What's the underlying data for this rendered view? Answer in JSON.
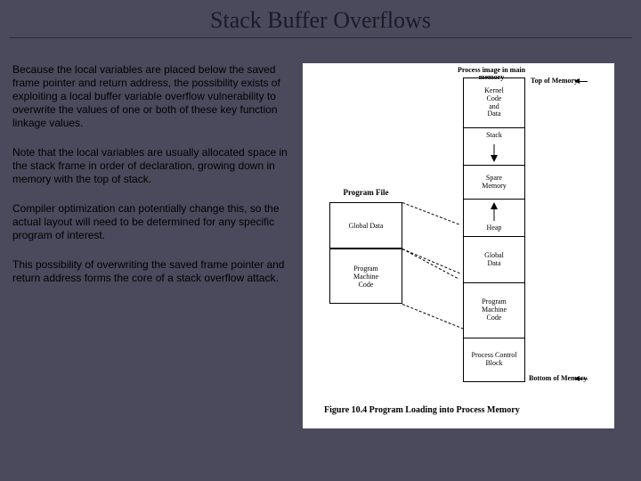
{
  "title": "Stack Buffer Overflows",
  "paragraphs": {
    "p1": "Because the local variables are placed below the saved frame pointer and return address, the possibility exists of exploiting a local buffer variable overflow vulnerability to overwrite the values of one or both of these key function linkage values.",
    "p2": "Note that the local variables are usually allocated space in the stack frame in order of declaration, growing down in memory with the top of stack.",
    "p3": "Compiler optimization can potentially change this, so the actual layout will need to be determined for any specific program of interest.",
    "p4": "This possibility of overwriting the saved frame pointer and return address forms the core of a stack overflow attack."
  },
  "figure": {
    "header": "Process image in\nmain memory",
    "top_label": "Top of Memory",
    "bottom_label": "Bottom of Memory",
    "program_file_label": "Program File",
    "program_file": {
      "global_data": "Global Data",
      "machine_code": "Program\nMachine\nCode"
    },
    "memory": {
      "kernel": "Kernel\nCode\nand\nData",
      "stack": "Stack",
      "spare": "Spare\nMemory",
      "heap": "Heap",
      "global_data": "Global\nData",
      "machine_code": "Program\nMachine\nCode",
      "pcb": "Process Control Block"
    },
    "caption": "Figure 10.4   Program Loading into Process Memory"
  }
}
